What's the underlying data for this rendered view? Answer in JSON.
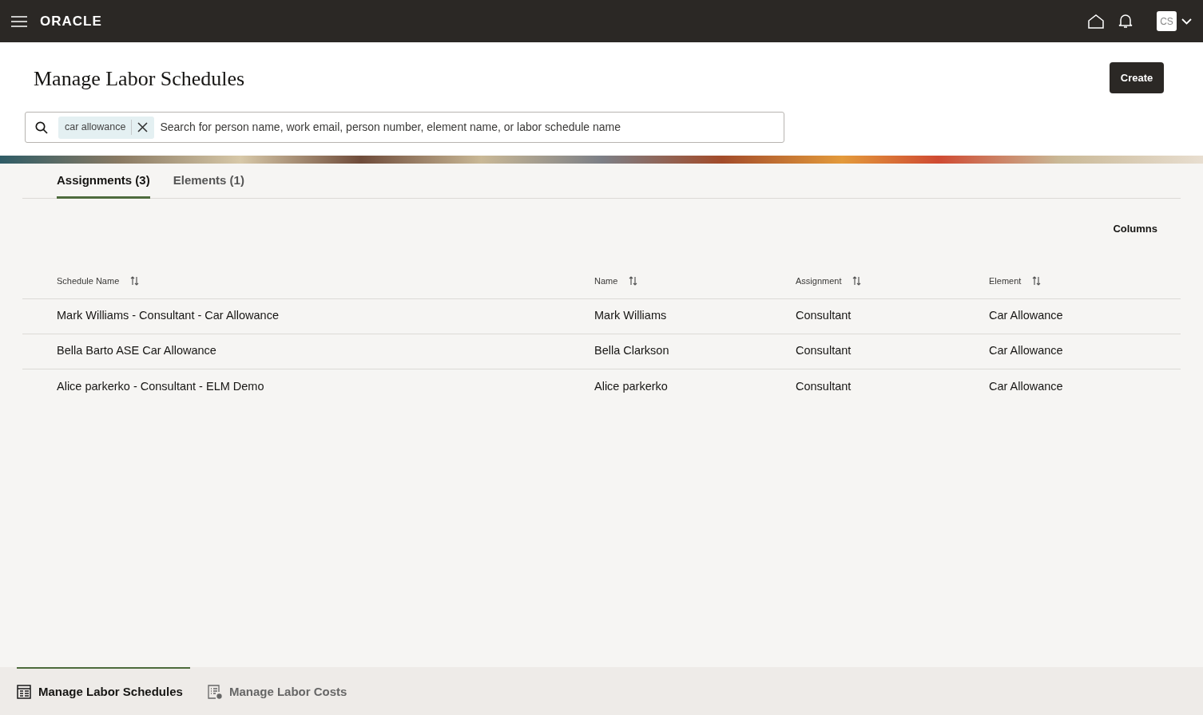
{
  "header": {
    "logo": "ORACLE",
    "avatar": "CS"
  },
  "page": {
    "title": "Manage Labor Schedules",
    "create_button": "Create"
  },
  "search": {
    "chip": "car allowance",
    "placeholder": "Search for person name, work email, person number, element name, or labor schedule name"
  },
  "tabs": [
    {
      "label": "Assignments (3)",
      "selected": true
    },
    {
      "label": "Elements (1)",
      "selected": false
    }
  ],
  "columns_button": "Columns",
  "table": {
    "columns": [
      "Schedule Name",
      "Name",
      "Assignment",
      "Element"
    ],
    "rows": [
      [
        "Mark Williams - Consultant - Car Allowance",
        "Mark Williams",
        "Consultant",
        "Car Allowance"
      ],
      [
        "Bella Barto ASE Car Allowance",
        "Bella Clarkson",
        "Consultant",
        "Car Allowance"
      ],
      [
        "Alice parkerko - Consultant - ELM Demo",
        "Alice parkerko",
        "Consultant",
        "Car Allowance"
      ]
    ]
  },
  "bottom_nav": [
    {
      "label": "Manage Labor Schedules",
      "kind": "schedules",
      "selected": true
    },
    {
      "label": "Manage Labor Costs",
      "kind": "costs",
      "selected": false
    }
  ]
}
